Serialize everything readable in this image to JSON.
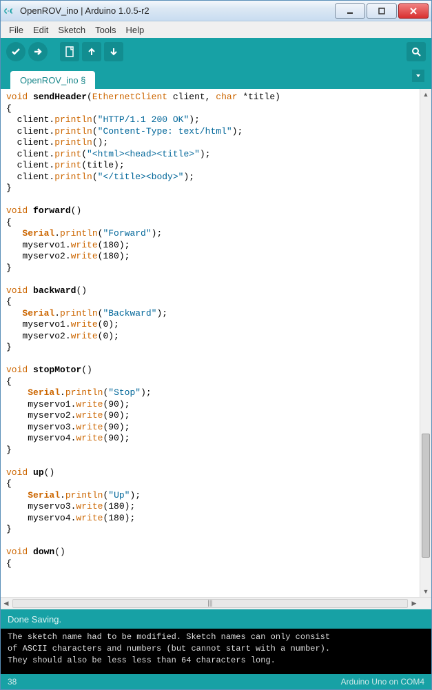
{
  "window": {
    "title": "OpenROV_ino | Arduino 1.0.5-r2"
  },
  "menu": {
    "file": "File",
    "edit": "Edit",
    "sketch": "Sketch",
    "tools": "Tools",
    "help": "Help"
  },
  "tab": {
    "name": "OpenROV_ino §"
  },
  "code": {
    "lines": [
      {
        "t": "fn_sig",
        "kw": "void",
        "name": "sendHeader",
        "params_pre": "(",
        "cls": "EthernetClient",
        "params_mid": " client, ",
        "kw2": "char",
        "params_post": " *title)"
      },
      {
        "t": "plain",
        "text": "{"
      },
      {
        "t": "call",
        "indent": "  ",
        "obj": "client",
        "dot": ".",
        "fn": "println",
        "open": "(",
        "str": "\"HTTP/1.1 200 OK\"",
        "close": ");"
      },
      {
        "t": "call",
        "indent": "  ",
        "obj": "client",
        "dot": ".",
        "fn": "println",
        "open": "(",
        "str": "\"Content-Type: text/html\"",
        "close": ");"
      },
      {
        "t": "call",
        "indent": "  ",
        "obj": "client",
        "dot": ".",
        "fn": "println",
        "open": "(",
        "str": "",
        "close": ");"
      },
      {
        "t": "call",
        "indent": "  ",
        "obj": "client",
        "dot": ".",
        "fn": "print",
        "open": "(",
        "str": "\"<html><head><title>\"",
        "close": ");"
      },
      {
        "t": "call",
        "indent": "  ",
        "obj": "client",
        "dot": ".",
        "fn": "print",
        "open": "(",
        "arg": "title",
        "close": ");"
      },
      {
        "t": "call",
        "indent": "  ",
        "obj": "client",
        "dot": ".",
        "fn": "println",
        "open": "(",
        "str": "\"</title><body>\"",
        "close": ");"
      },
      {
        "t": "plain",
        "text": "}"
      },
      {
        "t": "blank"
      },
      {
        "t": "fn_sig",
        "kw": "void",
        "name": "forward",
        "params_pre": "()"
      },
      {
        "t": "plain",
        "text": "{"
      },
      {
        "t": "call",
        "indent": "   ",
        "obj": "Serial",
        "bold": true,
        "dot": ".",
        "fn": "println",
        "open": "(",
        "str": "\"Forward\"",
        "close": ");"
      },
      {
        "t": "call",
        "indent": "   ",
        "obj": "myservo1",
        "dot": ".",
        "fn": "write",
        "open": "(",
        "arg": "180",
        "close": ");"
      },
      {
        "t": "call",
        "indent": "   ",
        "obj": "myservo2",
        "dot": ".",
        "fn": "write",
        "open": "(",
        "arg": "180",
        "close": ");"
      },
      {
        "t": "plain",
        "text": "}"
      },
      {
        "t": "blank"
      },
      {
        "t": "fn_sig",
        "kw": "void",
        "name": "backward",
        "params_pre": "()"
      },
      {
        "t": "plain",
        "text": "{"
      },
      {
        "t": "call",
        "indent": "   ",
        "obj": "Serial",
        "bold": true,
        "dot": ".",
        "fn": "println",
        "open": "(",
        "str": "\"Backward\"",
        "close": ");"
      },
      {
        "t": "call",
        "indent": "   ",
        "obj": "myservo1",
        "dot": ".",
        "fn": "write",
        "open": "(",
        "arg": "0",
        "close": ");"
      },
      {
        "t": "call",
        "indent": "   ",
        "obj": "myservo2",
        "dot": ".",
        "fn": "write",
        "open": "(",
        "arg": "0",
        "close": ");"
      },
      {
        "t": "plain",
        "text": "}"
      },
      {
        "t": "blank"
      },
      {
        "t": "fn_sig",
        "kw": "void",
        "name": "stopMotor",
        "params_pre": "()"
      },
      {
        "t": "plain",
        "text": "{"
      },
      {
        "t": "call",
        "indent": "    ",
        "obj": "Serial",
        "bold": true,
        "dot": ".",
        "fn": "println",
        "open": "(",
        "str": "\"Stop\"",
        "close": ");"
      },
      {
        "t": "call",
        "indent": "    ",
        "obj": "myservo1",
        "dot": ".",
        "fn": "write",
        "open": "(",
        "arg": "90",
        "close": ");"
      },
      {
        "t": "call",
        "indent": "    ",
        "obj": "myservo2",
        "dot": ".",
        "fn": "write",
        "open": "(",
        "arg": "90",
        "close": ");"
      },
      {
        "t": "call",
        "indent": "    ",
        "obj": "myservo3",
        "dot": ".",
        "fn": "write",
        "open": "(",
        "arg": "90",
        "close": ");"
      },
      {
        "t": "call",
        "indent": "    ",
        "obj": "myservo4",
        "dot": ".",
        "fn": "write",
        "open": "(",
        "arg": "90",
        "close": ");"
      },
      {
        "t": "plain",
        "text": "}"
      },
      {
        "t": "blank"
      },
      {
        "t": "fn_sig",
        "kw": "void",
        "name": "up",
        "params_pre": "()"
      },
      {
        "t": "plain",
        "text": "{"
      },
      {
        "t": "call",
        "indent": "    ",
        "obj": "Serial",
        "bold": true,
        "dot": ".",
        "fn": "println",
        "open": "(",
        "str": "\"Up\"",
        "close": ");"
      },
      {
        "t": "call",
        "indent": "    ",
        "obj": "myservo3",
        "dot": ".",
        "fn": "write",
        "open": "(",
        "arg": "180",
        "close": ");"
      },
      {
        "t": "call",
        "indent": "    ",
        "obj": "myservo4",
        "dot": ".",
        "fn": "write",
        "open": "(",
        "arg": "180",
        "close": ");"
      },
      {
        "t": "plain",
        "text": "}"
      },
      {
        "t": "blank"
      },
      {
        "t": "fn_sig",
        "kw": "void",
        "name": "down",
        "params_pre": "()"
      },
      {
        "t": "plain",
        "text": "{"
      }
    ]
  },
  "status": {
    "text": "Done Saving."
  },
  "console": {
    "line1": "The sketch name had to be modified. Sketch names can only consist",
    "line2": "of ASCII characters and numbers (but cannot start with a number).",
    "line3": "They should also be less less than 64 characters long."
  },
  "footer": {
    "line": "38",
    "board": "Arduino Uno on COM4"
  }
}
